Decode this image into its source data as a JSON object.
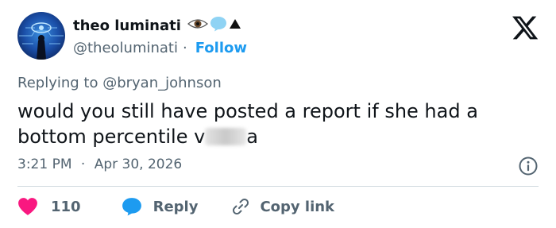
{
  "author": {
    "display_name": "theo luminati",
    "emoji_icons": [
      "eye-icon",
      "speech-bubble-icon",
      "black-triangle-icon"
    ],
    "handle": "@theoluminati",
    "separator": "·",
    "follow_label": "Follow"
  },
  "brand": {
    "logo": "x-logo",
    "accent": "#1d9bf0"
  },
  "tweet": {
    "replying_to": "Replying to @bryan_johnson",
    "text_part1": "would you still have posted a report if she had a bottom percentile v",
    "text_part2": "a",
    "time": "3:21 PM",
    "separator": "·",
    "date": "Apr 30, 2026"
  },
  "actions": {
    "like_count": "110",
    "like_color": "#f91880",
    "reply_label": "Reply",
    "reply_color": "#1d9bf0",
    "copy_label": "Copy link"
  }
}
